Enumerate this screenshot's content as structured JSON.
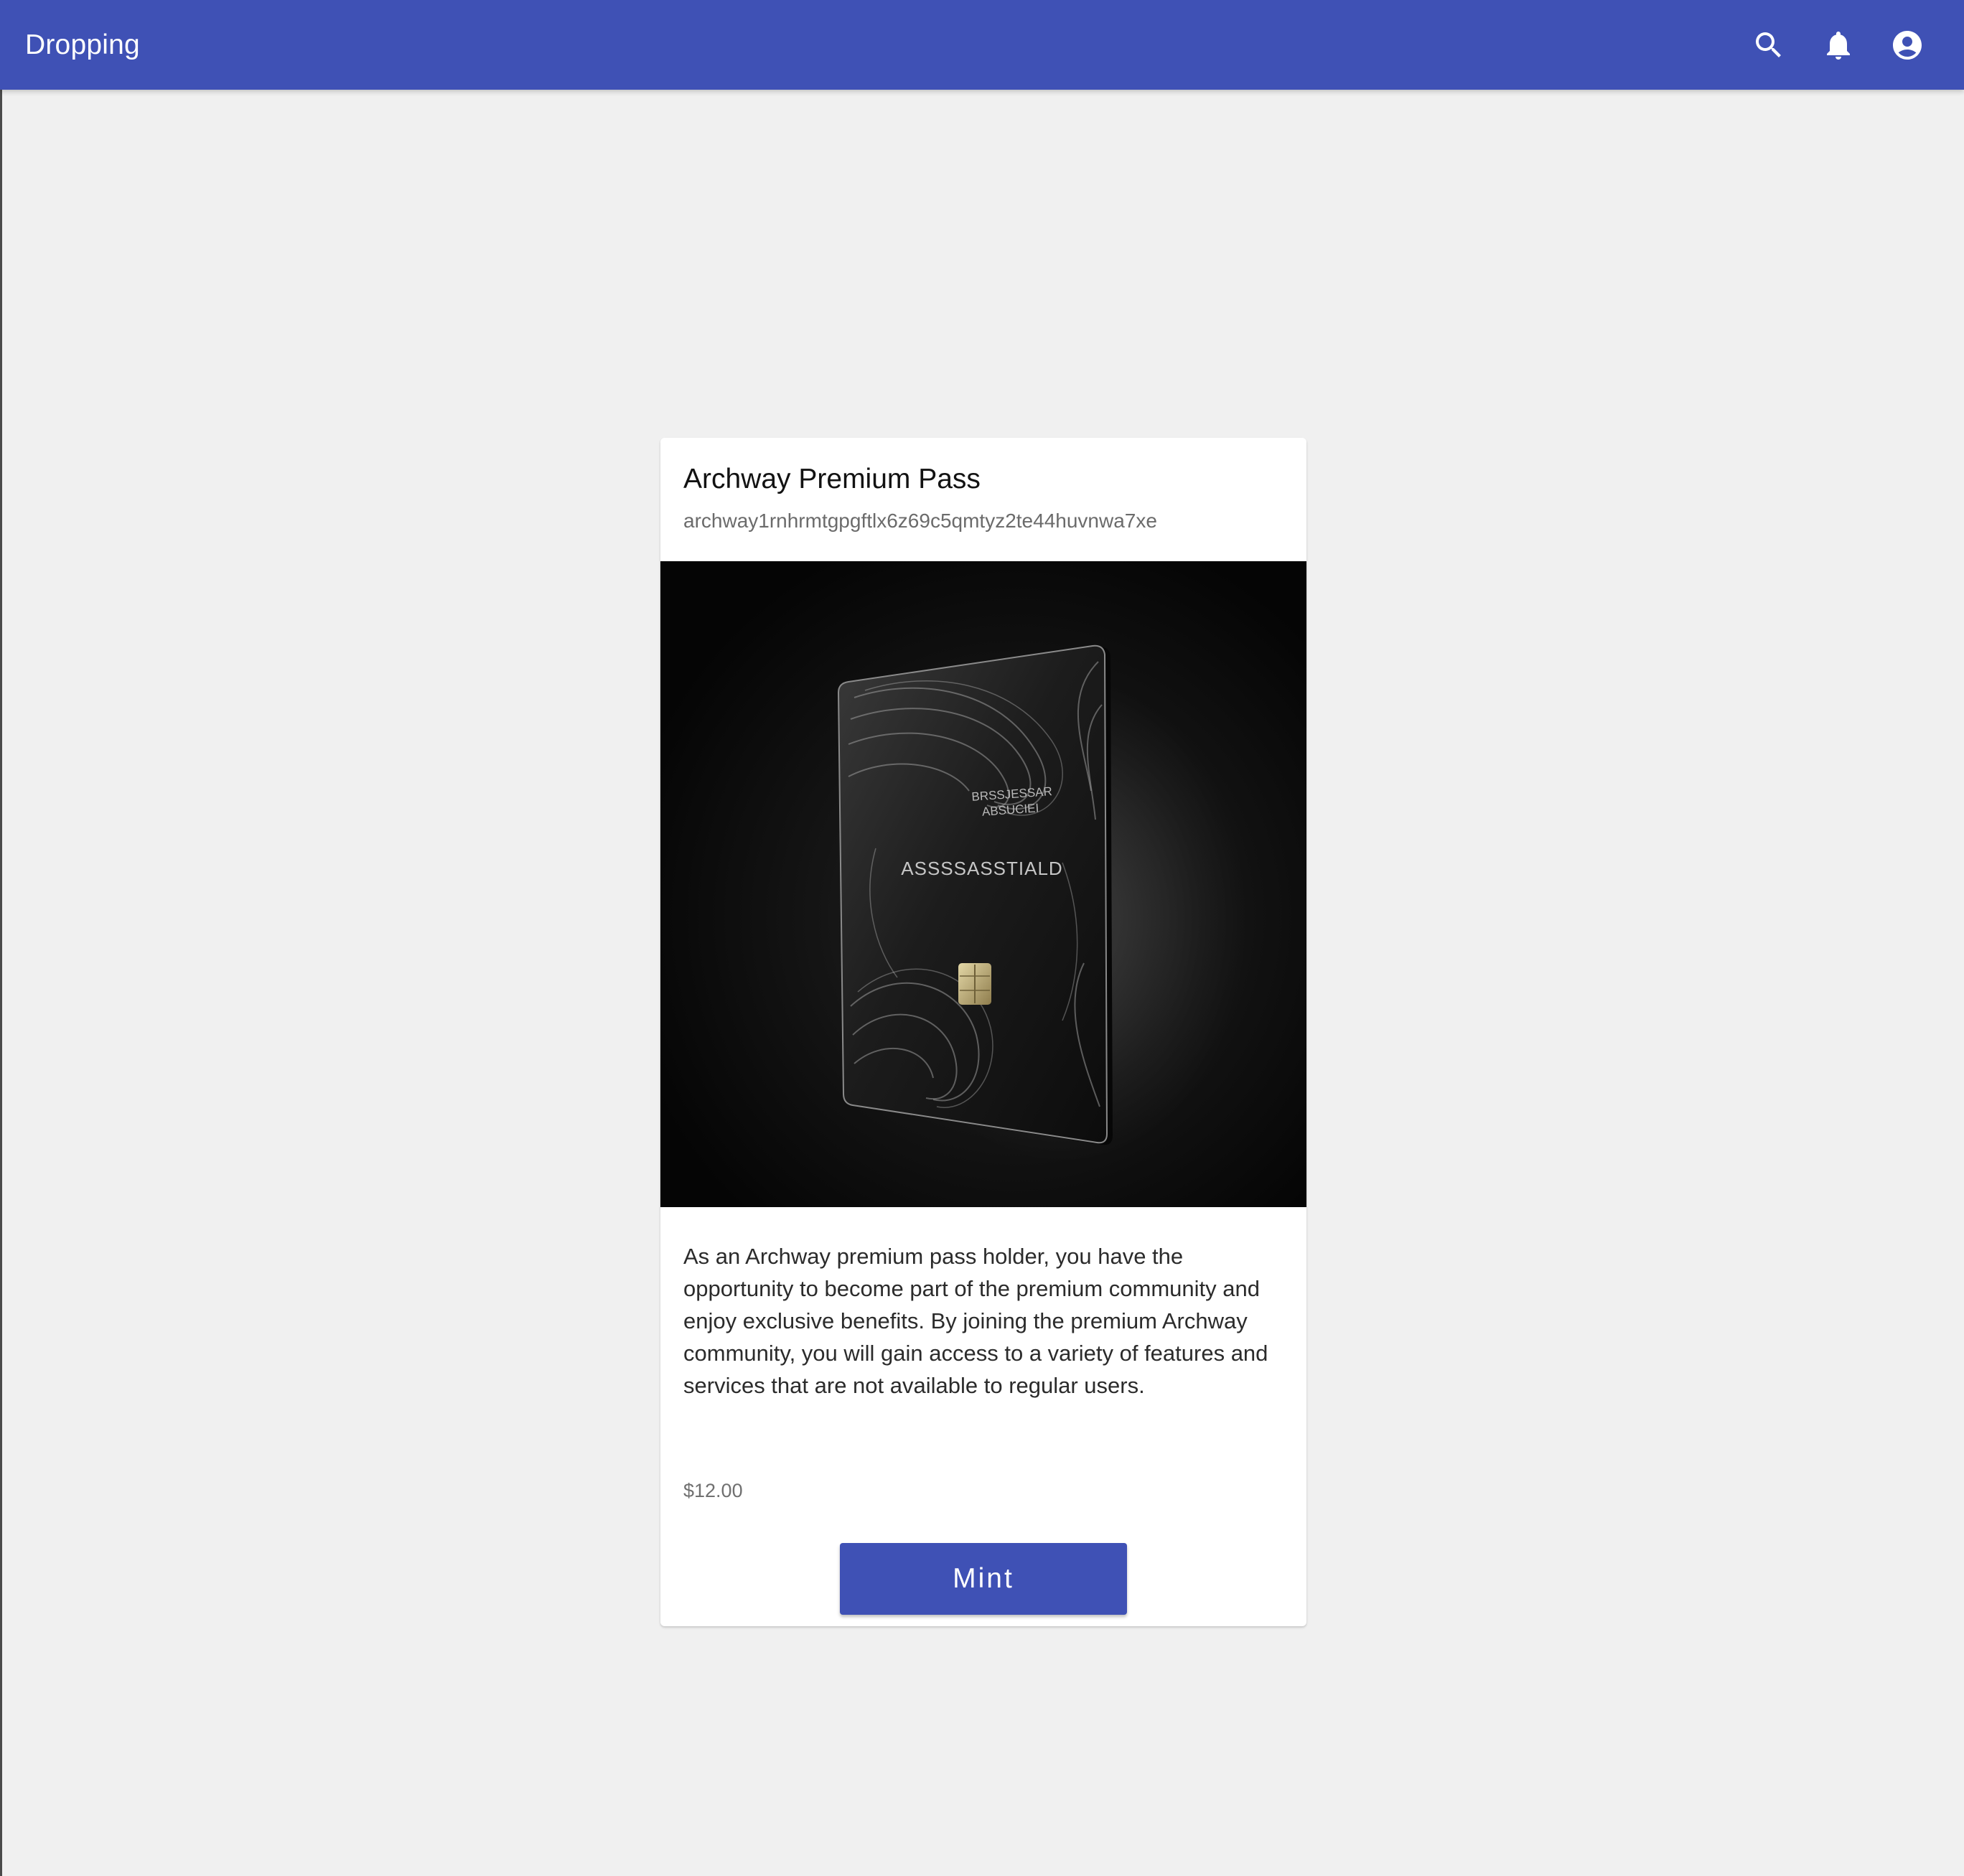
{
  "app_bar": {
    "title": "Dropping",
    "actions": [
      {
        "icon": "search-icon"
      },
      {
        "icon": "bell-icon"
      },
      {
        "icon": "account-circle-icon"
      }
    ],
    "color": "#3f51b5"
  },
  "card": {
    "title": "Archway Premium Pass",
    "subtitle": "archway1rnhrmtgpgftlx6z69c5qmtyz2te44huvnwa7xe",
    "image": {
      "card_text_top_line1": "BRSSJESSAR",
      "card_text_top_line2": "ABSUCIEI",
      "card_text_main": "ASSSSASSTIALD"
    },
    "description": "As an Archway premium pass holder, you have the opportunity to become part of the premium community and enjoy exclusive benefits. By joining the premium Archway community, you will gain access to a variety of features and services that are not available to regular users.",
    "price": "$12.00",
    "mint_label": "Mint"
  },
  "colors": {
    "accent": "#3f51b5",
    "background": "#f0f0f0",
    "card": "#ffffff"
  }
}
